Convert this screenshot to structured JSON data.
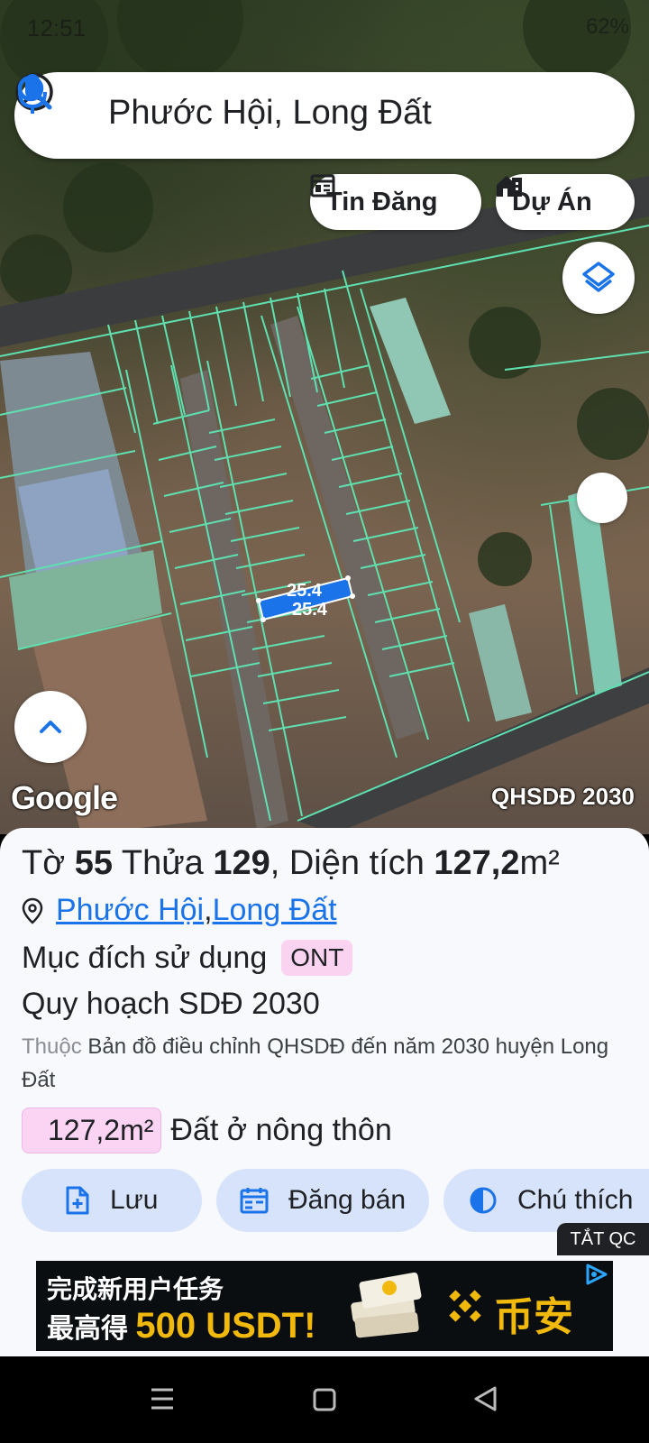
{
  "status_bar": {
    "time": "12:51",
    "right": "62%"
  },
  "search": {
    "text": "Phước Hội, Long Đất"
  },
  "chips": {
    "tin_dang": "Tin Đăng",
    "du_an": "Dự Án"
  },
  "map": {
    "parcel_label_top": "25.4",
    "parcel_label_bottom": "25.4",
    "attribution": "Google",
    "layer_name": "QHSDĐ 2030"
  },
  "sheet": {
    "title": {
      "prefix": "Tờ ",
      "sheet_no": "55",
      "mid": " Thửa ",
      "parcel_no": "129",
      "sep": ", Diện tích ",
      "area": "127,2",
      "unit": "m²"
    },
    "location": {
      "ward": "Phước Hội",
      "separator": ", ",
      "district": "Long Đất"
    },
    "purpose_label": "Mục đích sử dụng",
    "purpose_code": "ONT",
    "plan_title": "Quy hoạch SDĐ 2030",
    "desc_prefix": "Thuộc",
    "desc_text": " Bản đồ điều chỉnh QHSDĐ đến năm 2030 huyện Long Đất",
    "area_badge": "127,2m²",
    "area_type": "Đất ở nông thôn",
    "actions": {
      "save": "Lưu",
      "sell": "Đăng bán",
      "legend": "Chú thích"
    },
    "ad_off": "TẮT QC"
  },
  "ad": {
    "line1": "完成新用户任务",
    "line2_prefix": "最高得 ",
    "line2_highlight": "500 USDT!",
    "brand": "币安"
  },
  "colors": {
    "accent": "#1a73e8",
    "parcel_lines": "#5fe0b0",
    "ad_gold": "#f0b90b"
  }
}
